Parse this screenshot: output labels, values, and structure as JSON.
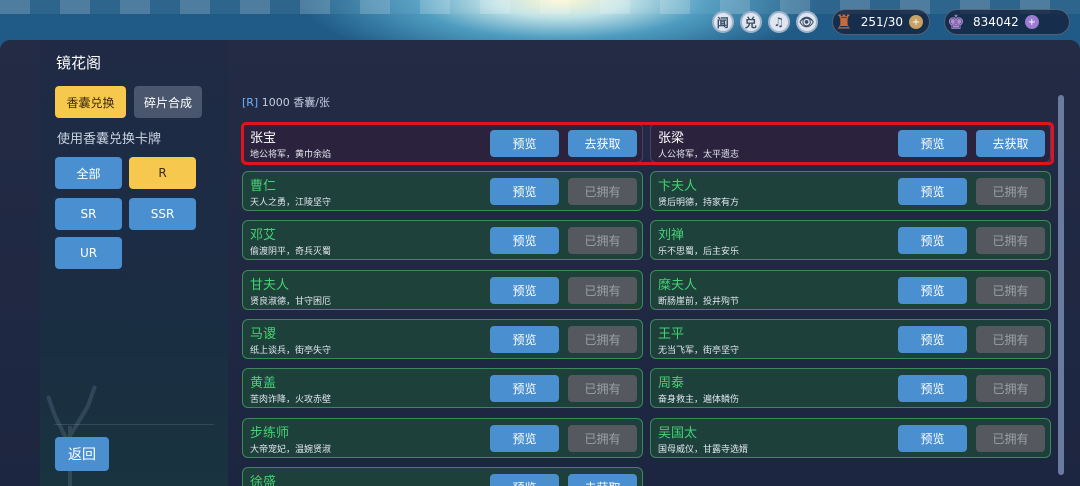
{
  "hud": {
    "buttons": [
      {
        "label": "闻",
        "icon": "news-icon"
      },
      {
        "label": "兑",
        "icon": "exchange-icon"
      },
      {
        "label": "♫",
        "icon": "music-icon"
      },
      {
        "label": "👁",
        "icon": "eye-icon"
      }
    ],
    "sachet_count": "251/30",
    "jade_count": "834042",
    "plus": "+"
  },
  "sidebar": {
    "title": "镜花阁",
    "tabs": {
      "active": "香囊兑换",
      "inactive": "碎片合成"
    },
    "subtitle": "使用香囊兑换卡牌",
    "filters": [
      "全部",
      "R",
      "SR",
      "SSR",
      "UR"
    ],
    "selected_filter": "R",
    "back_label": "返回"
  },
  "content": {
    "price_tag": "[R]",
    "price_text": "1000 香囊/张",
    "preview_label": "预览",
    "get_label": "去获取",
    "owned_label": "已拥有",
    "cards": [
      {
        "name": "张宝",
        "desc": "地公将军，黄巾余焰",
        "status": "get",
        "featured": true
      },
      {
        "name": "张梁",
        "desc": "人公将军，太平遗志",
        "status": "get",
        "featured": true
      },
      {
        "name": "曹仁",
        "desc": "天人之勇，江陵坚守",
        "status": "owned"
      },
      {
        "name": "卞夫人",
        "desc": "贤后明德，持家有方",
        "status": "owned"
      },
      {
        "name": "邓艾",
        "desc": "偷渡阴平，奇兵灭蜀",
        "status": "owned"
      },
      {
        "name": "刘禅",
        "desc": "乐不思蜀，后主安乐",
        "status": "owned"
      },
      {
        "name": "甘夫人",
        "desc": "贤良淑德，甘守困厄",
        "status": "owned"
      },
      {
        "name": "糜夫人",
        "desc": "断肠崖前，投井殉节",
        "status": "owned"
      },
      {
        "name": "马谡",
        "desc": "纸上谈兵，街亭失守",
        "status": "owned"
      },
      {
        "name": "王平",
        "desc": "无当飞军，街亭坚守",
        "status": "owned"
      },
      {
        "name": "黄盖",
        "desc": "苦肉诈降，火攻赤壁",
        "status": "owned"
      },
      {
        "name": "周泰",
        "desc": "奋身救主，遍体鳞伤",
        "status": "owned"
      },
      {
        "name": "步练师",
        "desc": "大帝宠妃，温婉贤淑",
        "status": "owned"
      },
      {
        "name": "吴国太",
        "desc": "国母威仪，甘露寺选婿",
        "status": "owned"
      },
      {
        "name": "徐盛",
        "desc": "",
        "status": "get"
      }
    ]
  }
}
